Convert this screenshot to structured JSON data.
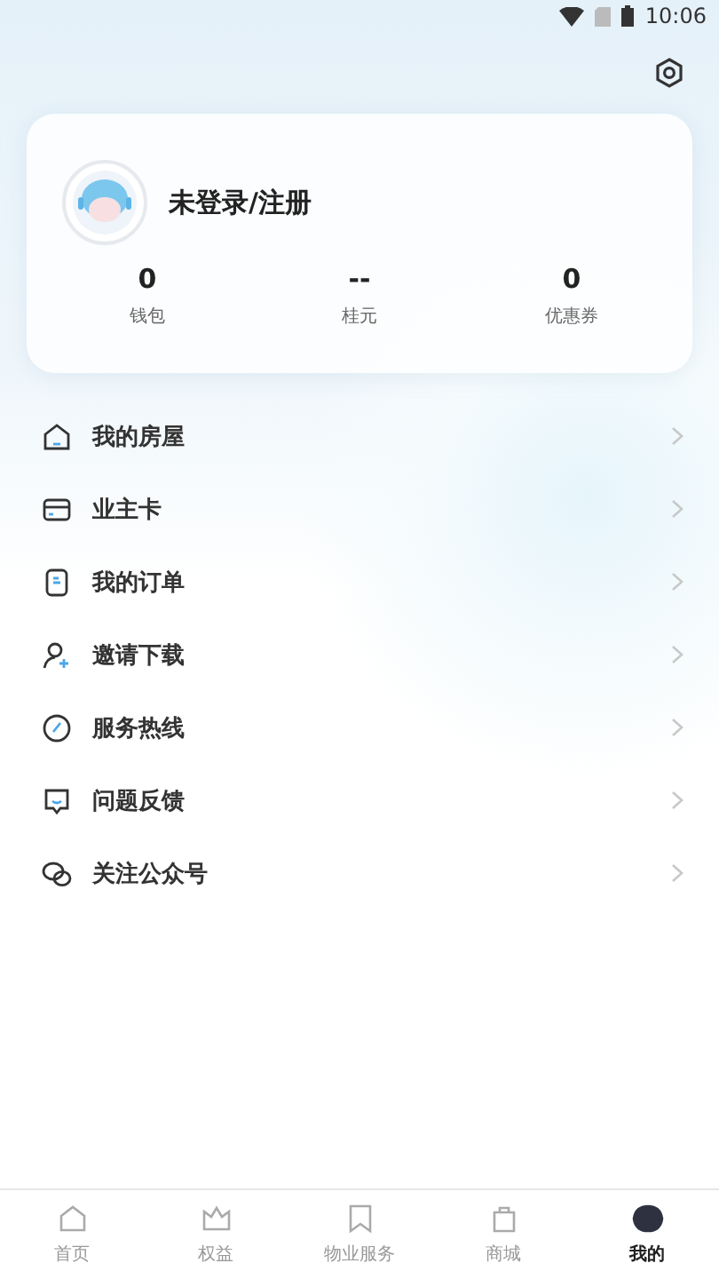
{
  "status_bar": {
    "time": "10:06"
  },
  "profile": {
    "name": "未登录/注册",
    "stats": [
      {
        "value": "0",
        "label": "钱包"
      },
      {
        "value": "--",
        "label": "桂元"
      },
      {
        "value": "0",
        "label": "优惠券"
      }
    ]
  },
  "menu": [
    {
      "kind": "house",
      "label": "我的房屋"
    },
    {
      "kind": "card",
      "label": "业主卡"
    },
    {
      "kind": "order",
      "label": "我的订单"
    },
    {
      "kind": "invite",
      "label": "邀请下载"
    },
    {
      "kind": "phone",
      "label": "服务热线"
    },
    {
      "kind": "feedback",
      "label": "问题反馈"
    },
    {
      "kind": "chat",
      "label": "关注公众号"
    }
  ],
  "tabs": [
    {
      "kind": "home",
      "label": "首页",
      "selected": false
    },
    {
      "kind": "crown",
      "label": "权益",
      "selected": false
    },
    {
      "kind": "bookmark",
      "label": "物业服务",
      "selected": false
    },
    {
      "kind": "bag",
      "label": "商城",
      "selected": false
    },
    {
      "kind": "me",
      "label": "我的",
      "selected": true
    }
  ]
}
